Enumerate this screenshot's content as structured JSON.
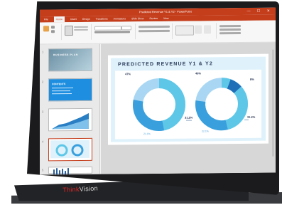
{
  "device": {
    "brand_prefix": "Think",
    "brand_suffix": "Vision"
  },
  "app": {
    "window_title": "Predicted Revenue Y1 & Y2 - PowerPoint",
    "tabs": [
      "File",
      "Home",
      "Insert",
      "Design",
      "Transitions",
      "Animations",
      "Slide Show",
      "Review",
      "View"
    ],
    "active_tab": "Home"
  },
  "slides": [
    {
      "num": "1",
      "text": "BUSINESS PLAN"
    },
    {
      "num": "2",
      "text": "CONTENTS"
    },
    {
      "num": "3",
      "text": ""
    },
    {
      "num": "4",
      "text": ""
    },
    {
      "num": "5",
      "text": ""
    }
  ],
  "slide": {
    "title": "PREDICTED REVENUE Y1 & Y2",
    "left_top_pct": "47%",
    "right_top_pct": "46%",
    "right_small_pct": "8%",
    "left_side_pct": "31.2%",
    "right_side_pct": "31.2%",
    "left_bottom_pct": "21.1%",
    "right_bottom_pct": "22.1%"
  },
  "colors": {
    "accent": "#c43e1c",
    "donut_light": "#5ec7e8",
    "donut_mid": "#3aa0dd",
    "donut_dark": "#1f6fb8",
    "donut_pale": "#a9d7f3"
  }
}
